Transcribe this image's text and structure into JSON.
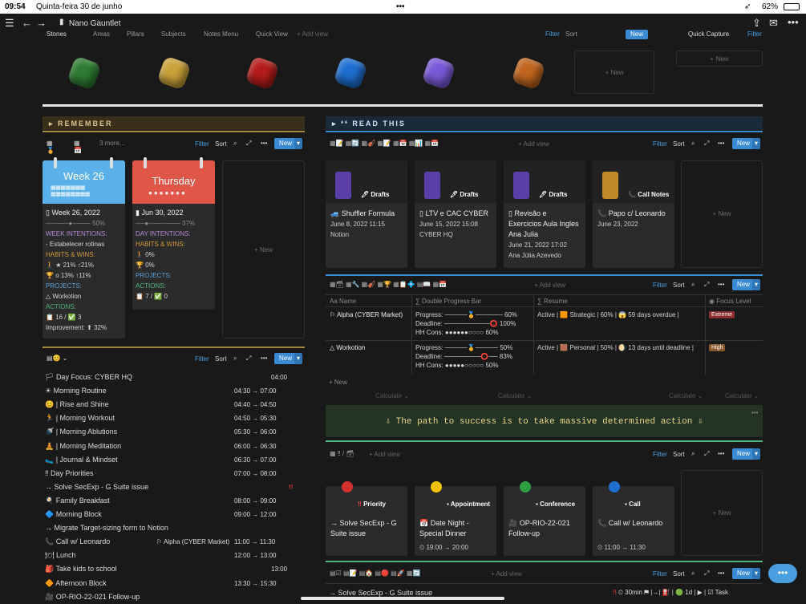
{
  "status": {
    "time": "09:54",
    "date": "Quinta-feira 30 de junho",
    "battery": "62%"
  },
  "app": {
    "title": "Nano Gauntlet"
  },
  "top_tabs": [
    "Stones",
    "Areas",
    "Pillars",
    "Subjects",
    "Notes Menu",
    "Quick View",
    "+ Add view"
  ],
  "top_tools": {
    "filter": "Filter",
    "sort": "Sort",
    "new": "New",
    "quick_capture": "Quick Capture",
    "new2": "+ New",
    "new3": "+ New"
  },
  "gems": [
    {
      "name": "green-stone",
      "color": "#2e7d32"
    },
    {
      "name": "yellow-stone",
      "color": "#c9a23a"
    },
    {
      "name": "red-stone",
      "color": "#b71c1c"
    },
    {
      "name": "blue-stone",
      "color": "#1e6fd0"
    },
    {
      "name": "purple-stone",
      "color": "#7a5ad8"
    },
    {
      "name": "orange-stone",
      "color": "#c0651e"
    }
  ],
  "remember": {
    "banner": "REMEMBER",
    "tabs": [
      "3 more..."
    ],
    "filter": "Filter",
    "sort": "Sort",
    "new": "New",
    "week": {
      "header": "Week 26",
      "title": "Week 26, 2022",
      "progress": "50%",
      "intentions_h": "WEEK INTENTIONS:",
      "intention": "- Estabelecer rotinas",
      "habits_h": "HABITS & WINS:",
      "habit1": "★ 21% ↑21%",
      "habit2": "o 13% ↑11%",
      "projects_h": "PROJECTS:",
      "project": "Workotion",
      "actions_h": "ACTIONS:",
      "actions": "16 / ✅ 3",
      "improve": "Improvement:",
      "improve_v": "32%"
    },
    "day": {
      "header": "Thursday",
      "title": "Jun 30, 2022",
      "progress": "37%",
      "intentions_h": "DAY INTENTIONS:",
      "habits_h": "HABITS & WINS:",
      "habit1": "0%",
      "habit2": "0%",
      "projects_h": "PROJECTS:",
      "actions_h": "ACTIONS:",
      "actions": "7 / ✅ 0"
    },
    "new_card": "+ New"
  },
  "agenda": {
    "filter": "Filter",
    "sort": "Sort",
    "new": "New",
    "items": [
      {
        "label": "Day Focus: CYBER HQ",
        "time": "04:00"
      },
      {
        "label": "Morning Routine",
        "time": "04:30 → 07:00"
      },
      {
        "label": "| Rise and Shine",
        "time": "04:40 → 04:50"
      },
      {
        "label": "| Morning Workout",
        "time": "04:50 → 05:30"
      },
      {
        "label": "| Morning Ablutions",
        "time": "05:30 → 06:00"
      },
      {
        "label": "| Morning Meditation",
        "time": "06:00 → 06:30"
      },
      {
        "label": "| Journal & Mindset",
        "time": "06:30 → 07:00"
      },
      {
        "label": "Day Priorities",
        "time": "07:00 → 08:00"
      },
      {
        "label": "Solve SecExp - G Suite issue",
        "time": "!!"
      },
      {
        "label": "Family Breakfast",
        "time": "08:00 → 09:00"
      },
      {
        "label": "Morning Block",
        "time": "09:00 → 12:00"
      },
      {
        "label": "Migrate Target-sizing form to Notion",
        "time": ""
      },
      {
        "label": "Call w/ Leonardo",
        "time": "11:00 → 11:30",
        "extra": "Alpha (CYBER Market)"
      },
      {
        "label": "Lunch",
        "time": "12:00 → 13:00"
      },
      {
        "label": "Take kids to school",
        "time": "13:00"
      },
      {
        "label": "Afternoon Block",
        "time": "13:30 → 15:30"
      },
      {
        "label": "OP-RIO-22-021 Follow-up",
        "time": ""
      }
    ]
  },
  "read": {
    "banner": "READ THIS",
    "filter": "Filter",
    "sort": "Sort",
    "new": "New",
    "add_view": "+ Add view",
    "cards": [
      {
        "tag": "Drafts",
        "title": "Shuffler Formula",
        "date": "June 8, 2022 11:15",
        "rel": "Notion"
      },
      {
        "tag": "Drafts",
        "title": "LTV e CAC CYBER",
        "date": "June 15, 2022 15:08",
        "rel": "CYBER HQ"
      },
      {
        "tag": "Drafts",
        "title": "Revisão e Exercicios Aula Ingles Ana Julia",
        "date": "June 21, 2022 17:02",
        "rel": "Ana Júlia Azevedo"
      },
      {
        "tag": "Call Notes",
        "title": "Papo c/ Leonardo",
        "date": "June 23, 2022",
        "rel": ""
      }
    ],
    "new_card": "+ New"
  },
  "projects": {
    "filter": "Filter",
    "sort": "Sort",
    "new": "New",
    "add_view": "+ Add view",
    "cols": [
      "Name",
      "Double Progress Bar",
      "Resume",
      "Focus Level"
    ],
    "rows": [
      {
        "name": "Alpha (CYBER Market)",
        "p1": "Progress: ─────🏅────── 60%",
        "p2": "Deadline: ──────────⭕ 100%",
        "p3": "HH Cons: ●●●●●●○○○○ 60%",
        "resume": "Active | 🟧 Strategic | 60% | 😱 59 days overdue |",
        "focus": "Extreme",
        "fcolor": "#8b2e2e"
      },
      {
        "name": "Workotion",
        "p1": "Progress: ─────🏅───── 50%",
        "p2": "Deadline: ────────⭕── 83%",
        "p3": "HH Cons: ●●●●●○○○○○ 50%",
        "resume": "Active | 🟫 Personal | 50% | 🌖 13 days until deadline |",
        "focus": "High",
        "fcolor": "#8a5a2e"
      }
    ],
    "new_row": "+ New",
    "calc": "Calculate"
  },
  "quote": "⇩ The path to success is to take massive determined action ⇩",
  "tasks": {
    "filter": "Filter",
    "sort": "Sort",
    "new": "New",
    "add_view": "+ Add view",
    "cards": [
      {
        "tag": "Priority",
        "title": "Solve SecExp - G Suite issue",
        "time": "",
        "pin": "#d32f2f"
      },
      {
        "tag": "Appointment",
        "title": "Date Night - Special Dinner",
        "time": "19:00 → 20:00",
        "pin": "#f2c200"
      },
      {
        "tag": "Conference",
        "title": "OP-RIO-22-021 Follow-up",
        "time": "",
        "pin": "#2e9e44"
      },
      {
        "tag": "Call",
        "title": "Call w/ Leonardo",
        "time": "11:00 → 11:30",
        "pin": "#1e6fd0"
      }
    ],
    "new_card": "+ New"
  },
  "bottom": {
    "filter": "Filter",
    "sort": "Sort",
    "new": "New",
    "add_view": "+ Add view",
    "row": "Solve SecExp - G Suite issue",
    "dur": "30min",
    "d": "1d",
    "task": "Task"
  }
}
